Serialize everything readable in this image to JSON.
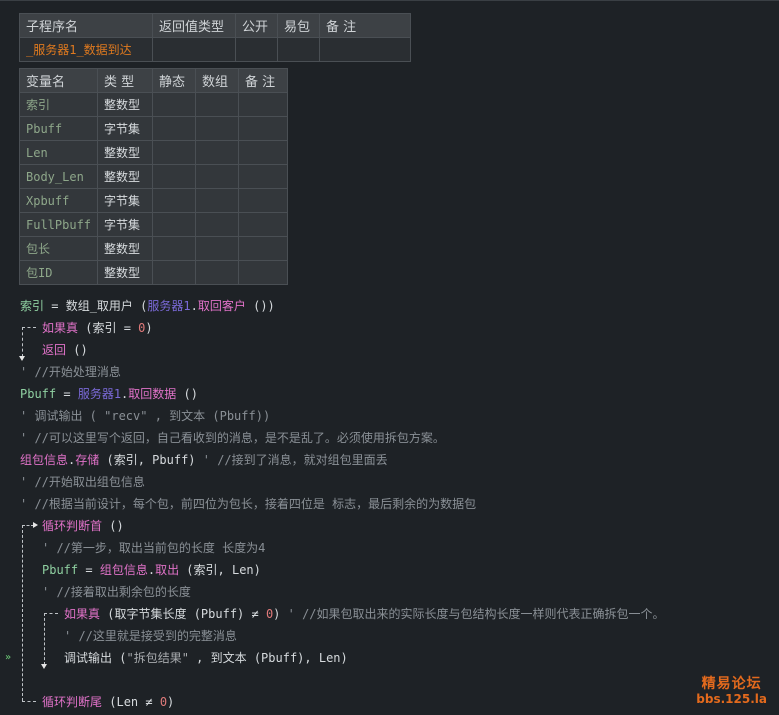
{
  "sub_table": {
    "headers": [
      "子程序名",
      "返回值类型",
      "公开",
      "易包",
      "备 注"
    ],
    "name": "_服务器1_数据到达"
  },
  "var_table": {
    "headers": [
      "变量名",
      "类 型",
      "静态",
      "数组",
      "备 注"
    ],
    "rows": [
      {
        "name": "索引",
        "type": "整数型"
      },
      {
        "name": "Pbuff",
        "type": "字节集"
      },
      {
        "name": "Len",
        "type": "整数型"
      },
      {
        "name": "Body_Len",
        "type": "整数型"
      },
      {
        "name": "Xpbuff",
        "type": "字节集"
      },
      {
        "name": "FullPbuff",
        "type": "字节集"
      },
      {
        "name": "包长",
        "type": "整数型"
      },
      {
        "name": "包ID",
        "type": "整数型"
      }
    ]
  },
  "code": {
    "l1": {
      "a": "索引",
      "b": " = ",
      "c": "数组_取用户",
      "d": " (",
      "e": "服务器1",
      "f": ".",
      "g": "取回客户",
      "h": " ())"
    },
    "l2": {
      "a": "如果真",
      "b": " (索引 = ",
      "c": "0",
      "d": ")"
    },
    "l3": {
      "a": "返回",
      "b": " ()"
    },
    "l4": {
      "a": "' //开始处理消息"
    },
    "l5": {
      "a": "Pbuff",
      "b": " = ",
      "c": "服务器1",
      "d": ".",
      "e": "取回数据",
      "f": " ()"
    },
    "l6": {
      "a": "' 调试输出 ( \"recv\" , 到文本 (Pbuff))"
    },
    "l7": {
      "a": "' //可以这里写个返回，自己看收到的消息，是不是乱了。必须使用拆包方案。"
    },
    "l8": {
      "a": "组包信息",
      "b": ".",
      "c": "存储",
      "d": " (索引, Pbuff)",
      "e": "  ' //接到了消息，就对组包里面丢"
    },
    "l9": {
      "a": "' //开始取出组包信息"
    },
    "l10": {
      "a": "' //根据当前设计，每个包，前四位为包长，接着四位是 标志，最后剩余的为数据包"
    },
    "l11": {
      "a": "循环判断首",
      "b": " ()"
    },
    "l12": {
      "a": "' //第一步，取出当前包的长度 长度为4"
    },
    "l13": {
      "a": "Pbuff",
      "b": " = ",
      "c": "组包信息",
      "d": ".",
      "e": "取出",
      "f": " (索引, Len)"
    },
    "l14": {
      "a": "' //接着取出剩余包的长度"
    },
    "l15": {
      "a": "如果真",
      "b": " (取字节集长度 (Pbuff) ≠ ",
      "c": "0",
      "d": ")",
      "e": "  ' //如果包取出来的实际长度与包结构长度一样则代表正确拆包一个。"
    },
    "l16": {
      "a": "' //这里就是接受到的完整消息"
    },
    "l17": {
      "a": "调试输出",
      "b": " (",
      "c": "\"拆包结果\"",
      "d": " , 到文本 (Pbuff), Len)"
    },
    "l18": {
      "a": "循环判断尾",
      "b": " (Len ≠ ",
      "c": "0",
      "d": ")"
    }
  },
  "gutter_marker": "»",
  "watermark": {
    "line1": "精易论坛",
    "line2": "bbs.125.la"
  }
}
